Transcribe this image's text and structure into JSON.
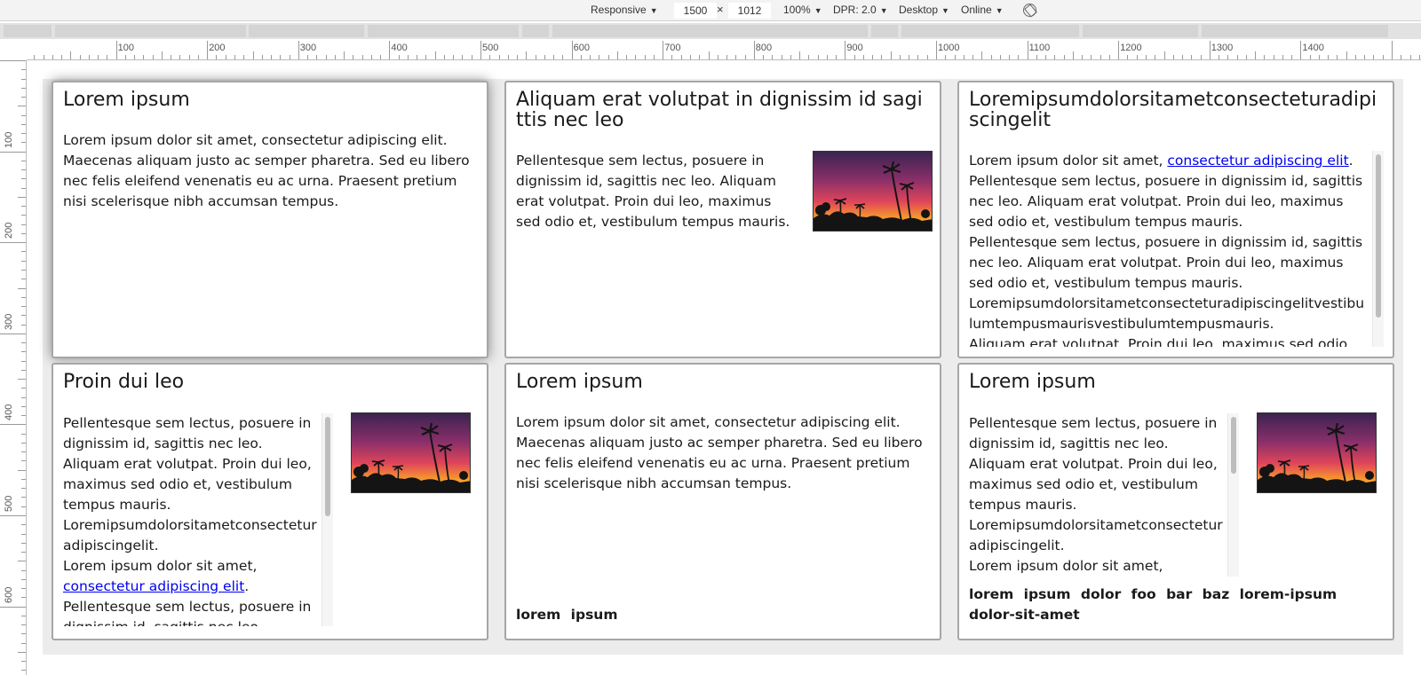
{
  "devtools": {
    "device_mode": "Responsive",
    "width": "1500",
    "times": "×",
    "height": "1012",
    "zoom": "100%",
    "dpr": "DPR: 2.0",
    "device_type": "Desktop",
    "network": "Online",
    "caret": "▼"
  },
  "ruler": {
    "h_labels": [
      "100",
      "200",
      "300",
      "400",
      "500",
      "600",
      "700",
      "800",
      "900",
      "1000",
      "1100",
      "1200",
      "1300",
      "1400"
    ],
    "v_labels": [
      "100",
      "200",
      "300",
      "400",
      "500",
      "600"
    ]
  },
  "cards": [
    {
      "title": "Lorem ipsum",
      "text": "Lorem ipsum dolor sit amet, consectetur adipiscing elit. Maecenas aliquam justo ac semper pharetra. Sed eu libero nec felis eleifend venenatis eu ac urna. Praesent pretium nisi scelerisque nibh accumsan tempus."
    },
    {
      "title": "Aliquam erat volutpat in dignissim id sagittis nec leo",
      "text": "Pellentesque sem lectus, posuere in dignissim id, sagittis nec leo. Aliquam erat volutpat. Proin dui leo, maximus sed odio et, vestibulum tempus mauris."
    },
    {
      "title": "Loremipsumdolorsitametconsecteturadipiscingelit",
      "text_before_link": "Lorem ipsum dolor sit amet, ",
      "link": "consectetur adipiscing elit",
      "text_after_link": ".",
      "text_line2": "Pellentesque sem lectus, posuere in dignissim id, sagittis nec leo. Aliquam erat volutpat. Proin dui leo, maximus sed odio et, vestibulum tempus mauris.",
      "text_line3": "Pellentesque sem lectus, posuere in dignissim id, sagittis nec leo. Aliquam erat volutpat. Proin dui leo, maximus sed odio et, vestibulum tempus mauris.",
      "text_line4": "Loremipsumdolorsitametconsecteturadipiscingelitvestibulumtempusmaurisvestibulumtempusmauris.",
      "text_line5": "Aliquam erat volutpat. Proin dui leo, maximus sed odio"
    },
    {
      "title": "Proin dui leo",
      "text_p1": "Pellentesque sem lectus, posuere in dignissim id, sagittis nec leo. Aliquam erat volutpat. Proin dui leo, maximus sed odio et, vestibulum tempus mauris.",
      "text_p2": "Loremipsumdolorsitametconsecteturadipiscingelit.",
      "text_p3": "Lorem ipsum dolor sit amet,",
      "link": "consectetur adipiscing elit",
      "text_after_link": ".",
      "text_p4": "Pellentesque sem lectus, posuere in dignissim id, sagittis nec leo. Aliquam"
    },
    {
      "title": "Lorem ipsum",
      "text": "Lorem ipsum dolor sit amet, consectetur adipiscing elit. Maecenas aliquam justo ac semper pharetra. Sed eu libero nec felis eleifend venenatis eu ac urna. Praesent pretium nisi scelerisque nibh accumsan tempus.",
      "tags": "lorem ipsum"
    },
    {
      "title": "Lorem ipsum",
      "text_p1": "Pellentesque sem lectus, posuere in dignissim id, sagittis nec leo. Aliquam erat volutpat. Proin dui leo, maximus sed odio et, vestibulum tempus mauris.",
      "text_p2": "Loremipsumdolorsitametconsecteturadipiscingelit.",
      "text_p3": "Lorem ipsum dolor sit amet,",
      "tags": "lorem ipsum dolor foo bar baz lorem-ipsum dolor-sit-amet"
    }
  ]
}
